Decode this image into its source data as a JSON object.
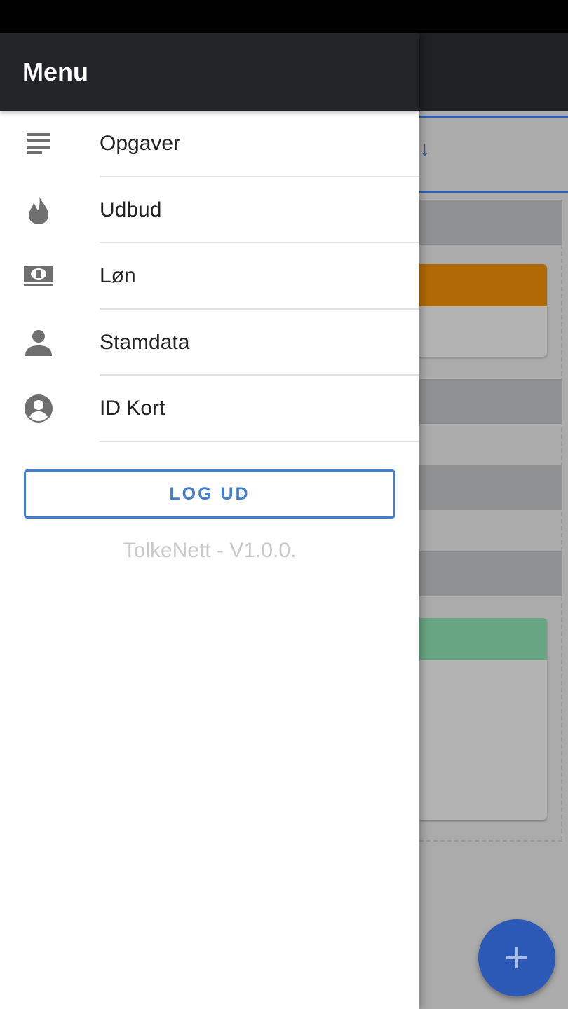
{
  "drawer": {
    "title": "Menu",
    "items": [
      {
        "label": "Opgaver",
        "icon": "list-icon"
      },
      {
        "label": "Udbud",
        "icon": "flame-icon"
      },
      {
        "label": "Løn",
        "icon": "money-icon"
      },
      {
        "label": "Stamdata",
        "icon": "person-icon"
      },
      {
        "label": "ID Kort",
        "icon": "account-circle-icon"
      }
    ],
    "logout_label": "LOG UD",
    "version": "TolkeNett - V1.0.0."
  },
  "colors": {
    "header": "#232427",
    "accent": "#3f7fd6",
    "fab": "#2c59b5",
    "card_orange": "#b06a05",
    "card_green": "#68a683"
  }
}
